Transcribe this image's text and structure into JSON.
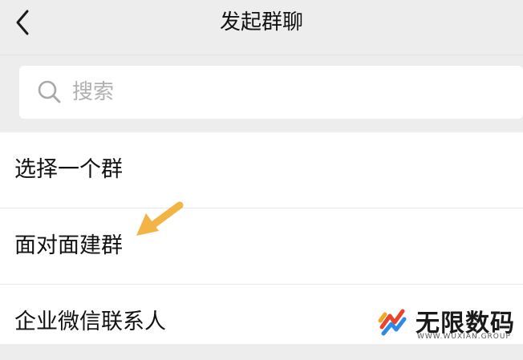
{
  "header": {
    "title": "发起群聊",
    "back_icon": "chevron-left-icon"
  },
  "search": {
    "placeholder": "搜索",
    "icon": "search-icon"
  },
  "list": {
    "items": [
      {
        "label": "选择一个群"
      },
      {
        "label": "面对面建群"
      },
      {
        "label": "企业微信联系人"
      }
    ]
  },
  "annotation": {
    "icon": "arrow-pointer-icon",
    "color": "#f2b445"
  },
  "watermark": {
    "title": "无限数码",
    "subtitle": "WWW.WUXIAN.GROUP"
  },
  "colors": {
    "background": "#ededed",
    "surface": "#ffffff",
    "text": "#111111",
    "placeholder": "#b0b0b0"
  }
}
